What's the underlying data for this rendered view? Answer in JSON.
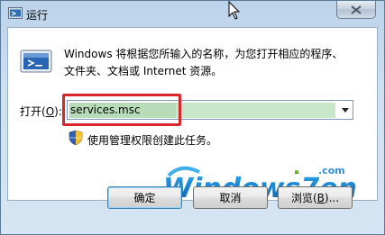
{
  "window": {
    "title": "运行",
    "title_icon": "run-icon",
    "close_icon": "close-icon"
  },
  "description": {
    "line1": "Windows 将根据您所输入的名称，为您打开相应的程序、",
    "line2": "文件夹、文档或 Internet 资源。"
  },
  "open_field": {
    "label": "打开(",
    "label_key": "O",
    "label_end": "):",
    "value": "services.msc"
  },
  "admin_note": "使用管理权限创建此任务。",
  "buttons": {
    "ok": "确定",
    "cancel": "取消",
    "browse": "浏览(",
    "browse_key": "B",
    "browse_end": ")..."
  },
  "watermark": {
    "text_main": "Windows7en",
    "text_sub": ".com"
  },
  "colors": {
    "highlight": "#d9262b",
    "field_selection": "#b8dcb8"
  }
}
